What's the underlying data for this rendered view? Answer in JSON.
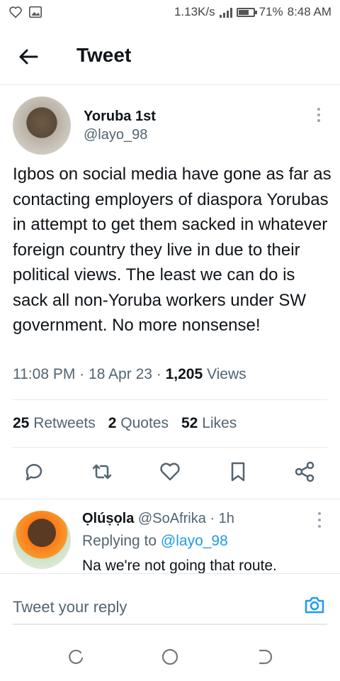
{
  "status_bar": {
    "network_speed": "1.13K/s",
    "battery_percent": "71%",
    "battery_level": 0.71,
    "time": "8:48 AM",
    "icons": [
      "heart-icon",
      "image-icon",
      "signal-icon",
      "battery-icon"
    ]
  },
  "header": {
    "title": "Tweet",
    "back_icon": "arrow-left-icon"
  },
  "tweet": {
    "author_name": "Yoruba 1st",
    "author_handle": "@layo_98",
    "text": "Igbos on social media have gone as far as contacting employers of diaspora Yorubas in attempt to get them sacked in whatever foreign country they live in due to their political views. The least we can do is sack all non-Yoruba workers under SW government. No more nonsense!",
    "time": "11:08 PM",
    "date": "18 Apr 23",
    "views_count": "1,205",
    "views_label": "Views",
    "separator": "·",
    "stats": {
      "retweets_count": "25",
      "retweets_label": "Retweets",
      "quotes_count": "2",
      "quotes_label": "Quotes",
      "likes_count": "52",
      "likes_label": "Likes"
    },
    "actions": [
      "reply-icon",
      "retweet-icon",
      "like-icon",
      "bookmark-icon",
      "share-icon"
    ]
  },
  "reply": {
    "name": "Ọlúṣọla",
    "handle": "@SoAfrika",
    "separator": "·",
    "time": "1h",
    "replying_label": "Replying to",
    "replying_handle": "@layo_98",
    "text": "Na we're not going that route."
  },
  "compose": {
    "placeholder": "Tweet your reply",
    "camera_icon": "camera-icon"
  },
  "colors": {
    "accent": "#1d9bf0",
    "text_primary": "#0f1419",
    "text_secondary": "#536471",
    "divider": "#e6e9ec"
  }
}
